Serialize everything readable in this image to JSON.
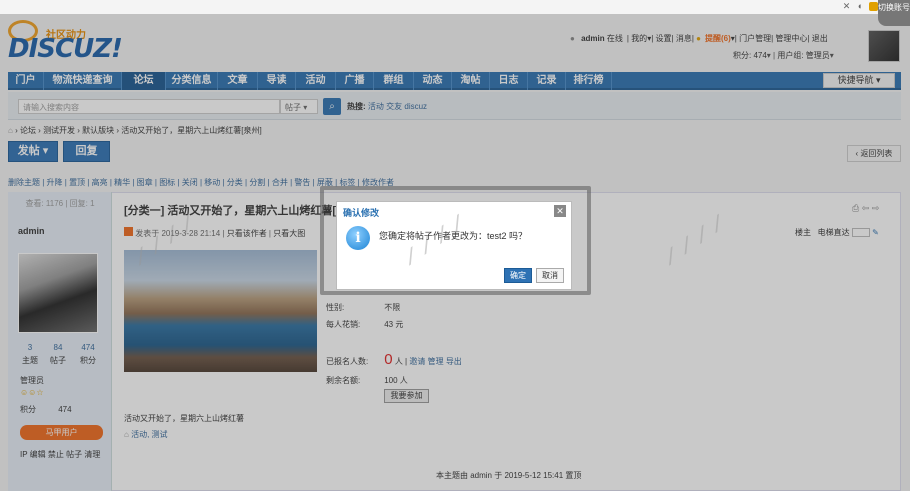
{
  "switch_account": "切换账号",
  "logo": {
    "slogan": "社区动力",
    "word": "DISCUZ!"
  },
  "userbar": {
    "username": "admin",
    "status": "在线",
    "my": "我的",
    "settings": "设置",
    "messages": "消息",
    "reminder": "提醒(6)",
    "portal_manage": "门户管理",
    "admin_center": "管理中心",
    "logout": "退出",
    "points": "积分: 474",
    "usergroup": "用户组: 管理员"
  },
  "nav": {
    "items": [
      "门户",
      "物流快递查询",
      "论坛",
      "分类信息",
      "文章",
      "导读",
      "活动",
      "广播",
      "群组",
      "动态",
      "淘帖",
      "日志",
      "记录",
      "排行榜"
    ],
    "quick_nav": "快捷导航"
  },
  "search": {
    "placeholder": "请输入搜索内容",
    "type": "帖子",
    "hot_label": "热搜:",
    "hot_words": [
      "活动",
      "交友",
      "discuz"
    ]
  },
  "breadcrumb": [
    "论坛",
    "测试开发",
    "默认版块",
    "活动又开始了，星期六上山烤红薯[泉州]"
  ],
  "buttons": {
    "post": "发帖",
    "reply": "回复",
    "back_list": "返回列表"
  },
  "mod_actions": [
    "删除主题",
    "升降",
    "置顶",
    "高亮",
    "精华",
    "图章",
    "图标",
    "关闭",
    "移动",
    "分类",
    "分割",
    "合并",
    "警告",
    "屏蔽",
    "标签",
    "修改作者"
  ],
  "thread": {
    "views": "查看: 1176",
    "replies": "回复: 1",
    "title": "[分类一] 活动又开始了，星期六上山烤红薯[泉州]",
    "meta": "发表于 2019-3-28 21:14",
    "only_author": "只看该作者",
    "only_image": "只看大图",
    "floor": "楼主",
    "goto_floor": "电梯直达",
    "body": "活动又开始了，星期六上山烤红薯",
    "tags": "活动, 测试",
    "last_edit": "本主题由 admin 于 2019-5-12 15:41 置顶"
  },
  "author": {
    "name": "admin",
    "stats": [
      {
        "num": "3",
        "label": "主题"
      },
      {
        "num": "84",
        "label": "帖子"
      },
      {
        "num": "474",
        "label": "积分"
      }
    ],
    "group": "管理员",
    "credit_label": "积分",
    "credit_value": "474",
    "majia": "马甲用户",
    "manage": [
      "IP",
      "编辑",
      "禁止",
      "帖子",
      "清理"
    ]
  },
  "activity": {
    "gender_label": "性别:",
    "gender_value": "不限",
    "fee_label": "每人花销:",
    "fee_value": "43 元",
    "signed_label": "已报名人数:",
    "signed_value": "0",
    "signed_unit": "人",
    "invite": "邀请",
    "manage": "管理",
    "export": "导出",
    "remaining_label": "剩余名额:",
    "remaining_value": "100 人",
    "join": "我要参加"
  },
  "dialog": {
    "title": "确认修改",
    "message": "您确定将帖子作者更改为：test2 吗？",
    "ok": "确定",
    "cancel": "取消"
  },
  "colors": {
    "nav_blue": "#2b71b1",
    "orange": "#f06a1c",
    "signed_red": "#e02020"
  }
}
